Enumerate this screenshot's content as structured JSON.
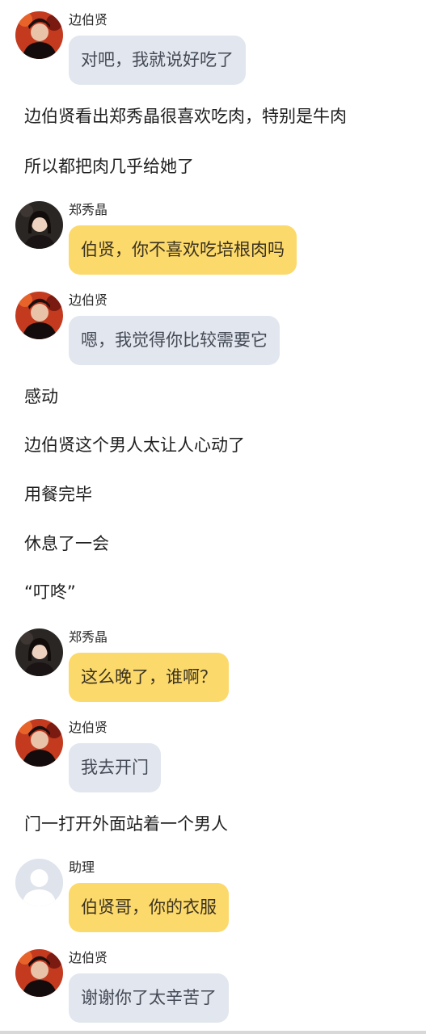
{
  "speakers": {
    "byun": "边伯贤",
    "jung": "郑秀晶",
    "assistant": "助理"
  },
  "messages": [
    {
      "speaker": "边伯贤",
      "text": "对吧，我就说好吃了"
    },
    {
      "speaker": "郑秀晶",
      "text": "伯贤，你不喜欢吃培根肉吗"
    },
    {
      "speaker": "边伯贤",
      "text": "嗯，我觉得你比较需要它"
    },
    {
      "speaker": "郑秀晶",
      "text": "这么晚了，谁啊？"
    },
    {
      "speaker": "边伯贤",
      "text": "我去开门"
    },
    {
      "speaker": "助理",
      "text": "伯贤哥，你的衣服"
    },
    {
      "speaker": "边伯贤",
      "text": "谢谢你了太辛苦了"
    }
  ],
  "narration": [
    "边伯贤看出郑秀晶很喜欢吃肉，特别是牛肉",
    "所以都把肉几乎给她了",
    "感动",
    "边伯贤这个男人太让人心动了",
    "用餐完毕",
    "休息了一会",
    "“叮咚”",
    "门一打开外面站着一个男人"
  ]
}
